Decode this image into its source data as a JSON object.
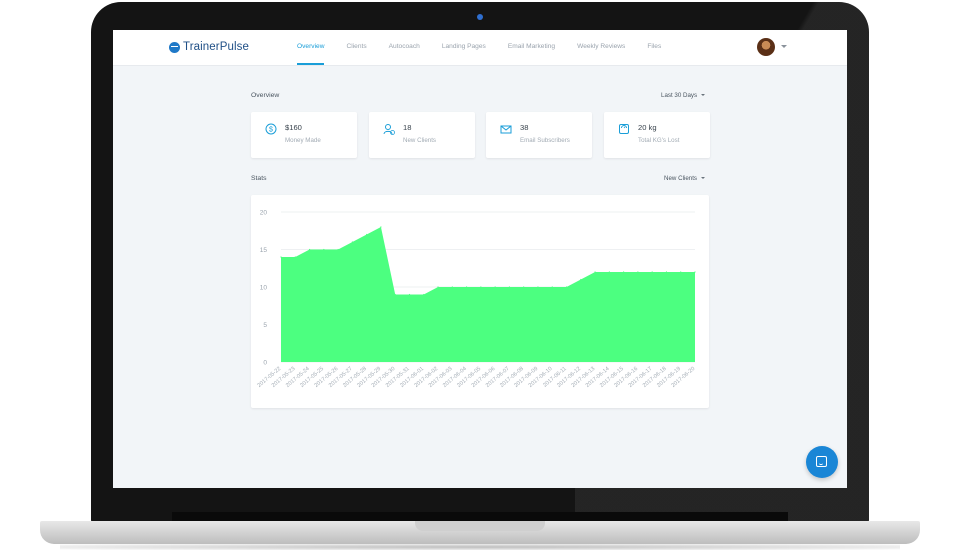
{
  "app": {
    "name": "TrainerPulse"
  },
  "nav": {
    "tabs": [
      {
        "label": "Overview",
        "active": true
      },
      {
        "label": "Clients",
        "active": false
      },
      {
        "label": "Autocoach",
        "active": false
      },
      {
        "label": "Landing Pages",
        "active": false
      },
      {
        "label": "Email Marketing",
        "active": false
      },
      {
        "label": "Weekly Reviews",
        "active": false
      },
      {
        "label": "Files",
        "active": false
      }
    ]
  },
  "overview": {
    "title": "Overview",
    "range_select": "Last 30 Days",
    "cards": [
      {
        "value": "$160",
        "label": "Money Made",
        "icon": "dollar-icon"
      },
      {
        "value": "18",
        "label": "New Clients",
        "icon": "user-icon"
      },
      {
        "value": "38",
        "label": "Email Subscribers",
        "icon": "envelope-icon"
      },
      {
        "value": "20 kg",
        "label": "Total KG's Lost",
        "icon": "scale-icon"
      }
    ]
  },
  "stats": {
    "title": "Stats",
    "metric_select": "New Clients"
  },
  "colors": {
    "accent": "#1a9ed8",
    "area_fill": "#4cff80",
    "brand": "#1f4f86"
  },
  "chart_data": {
    "type": "area",
    "x": [
      "2017-05-22",
      "2017-05-23",
      "2017-05-24",
      "2017-05-25",
      "2017-05-26",
      "2017-05-27",
      "2017-05-28",
      "2017-05-29",
      "2017-05-30",
      "2017-05-31",
      "2017-06-01",
      "2017-06-02",
      "2017-06-03",
      "2017-06-04",
      "2017-06-05",
      "2017-06-06",
      "2017-06-07",
      "2017-06-08",
      "2017-06-09",
      "2017-06-10",
      "2017-06-11",
      "2017-06-12",
      "2017-06-13",
      "2017-06-14",
      "2017-06-15",
      "2017-06-16",
      "2017-06-17",
      "2017-06-18",
      "2017-06-19",
      "2017-06-20"
    ],
    "y": [
      14,
      14,
      15,
      15,
      15,
      16,
      17,
      18,
      9,
      9,
      9,
      10,
      10,
      10,
      10,
      10,
      10,
      10,
      10,
      10,
      10,
      11,
      12,
      12,
      12,
      12,
      12,
      12,
      12,
      12
    ],
    "ylim": [
      0,
      20
    ],
    "yticks": [
      0,
      5,
      10,
      15,
      20
    ],
    "grid": true
  }
}
